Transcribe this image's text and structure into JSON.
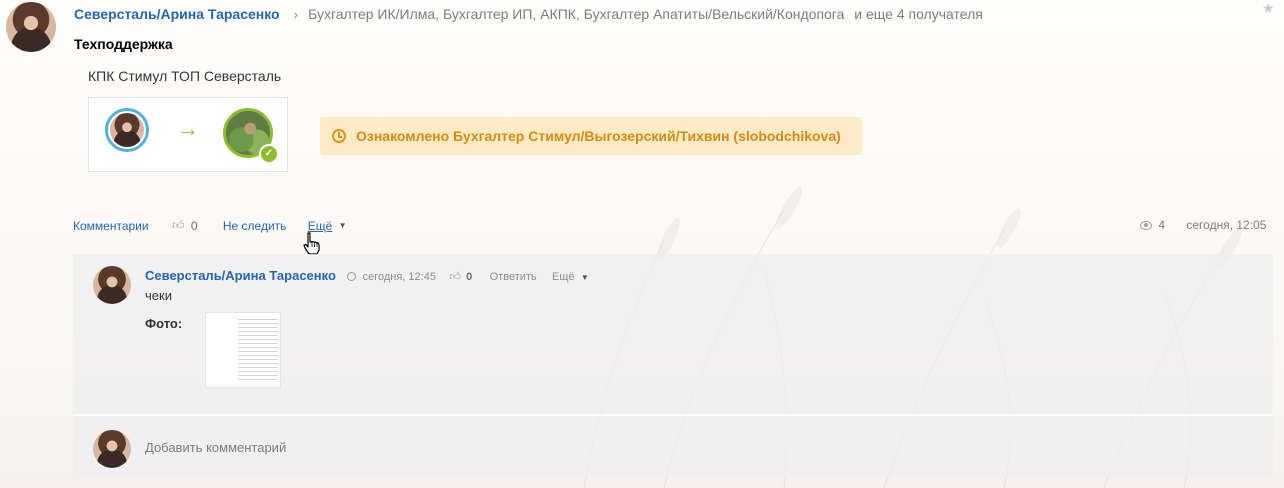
{
  "post": {
    "author": "Северсталь/Арина Тарасенко",
    "recipients": "Бухгалтер ИК/Илма, Бухгалтер ИП, АКПК, Бухгалтер Апатиты/Вельский/Кондопога",
    "more_recipients": "и еще 4 получателя",
    "title": "Техподдержка",
    "body": "КПК Стимул ТОП Северсталь",
    "acknowledged": "Ознакомлено Бухгалтер Стимул/Выгозерский/Тихвин (slobodchikova)",
    "actions": {
      "comments": "Комментарии",
      "likes": "0",
      "unfollow": "Не следить",
      "more": "Ещё"
    },
    "views": "4",
    "date": "сегодня, 12:05"
  },
  "comment": {
    "author": "Северсталь/Арина Тарасенко",
    "time": "сегодня, 12:45",
    "likes": "0",
    "reply": "Ответить",
    "more": "Ещё",
    "text": "чеки",
    "photo_label": "Фото:"
  },
  "add_comment": {
    "placeholder": "Добавить комментарий"
  },
  "icons": {
    "star": "star-icon",
    "chevron": "chevron-right-icon",
    "arrow": "arrow-right-icon",
    "check": "check-icon",
    "clock": "clock-icon",
    "like": "thumbs-up-icon",
    "eye": "eye-icon",
    "caret": "caret-down-icon",
    "cursor": "hand-pointer-icon"
  },
  "colors": {
    "link": "#2067b0",
    "ack_bg": "#fdebc7",
    "ack_text": "#d38a10",
    "accent_green": "#8dbd2a",
    "accent_blue": "#4fb3e0"
  }
}
